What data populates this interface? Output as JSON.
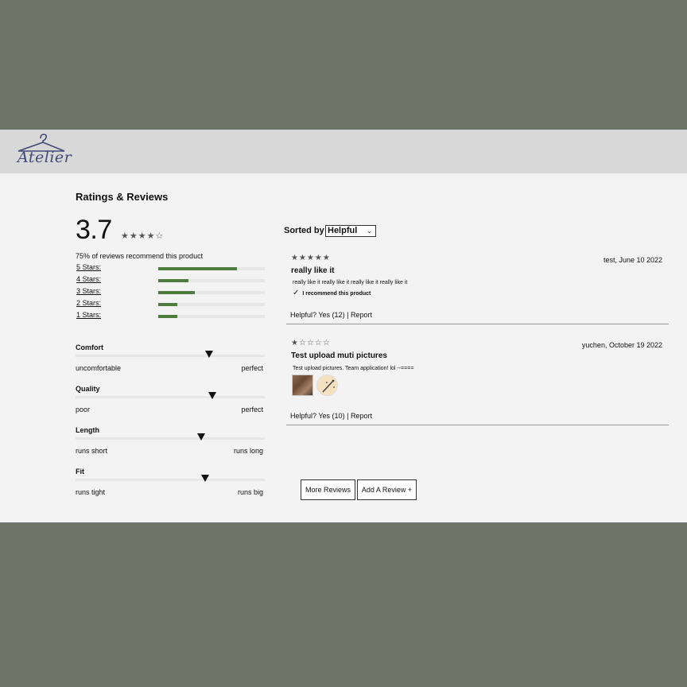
{
  "brand": {
    "logo_text": "Atelier"
  },
  "ratings": {
    "title": "Ratings & Reviews",
    "average": "3.7",
    "average_stars": "★★★★☆",
    "recommend_text": "75% of reviews recommend this product",
    "breakdown": [
      {
        "label": "5 Stars:",
        "fraction": 0.74
      },
      {
        "label": "4 Stars:",
        "fraction": 0.28
      },
      {
        "label": "3 Stars:",
        "fraction": 0.34
      },
      {
        "label": "2 Stars:",
        "fraction": 0.18
      },
      {
        "label": "1 Stars:",
        "fraction": 0.18
      }
    ],
    "characteristics": [
      {
        "name": "Comfort",
        "low": "uncomfortable",
        "high": "perfect",
        "value": 0.71
      },
      {
        "name": "Quality",
        "low": "poor",
        "high": "perfect",
        "value": 0.73
      },
      {
        "name": "Length",
        "low": "runs short",
        "high": "runs long",
        "value": 0.67
      },
      {
        "name": "Fit",
        "low": "runs tight",
        "high": "runs big",
        "value": 0.69
      }
    ]
  },
  "sort": {
    "label": "Sorted by",
    "selected": "Helpful"
  },
  "reviews": [
    {
      "stars": "★★★★★",
      "meta": "test, June 10 2022",
      "title": "really like it",
      "body": "really like it really like it really like it really like it",
      "recommend": "I recommend this product",
      "helpful_prefix": "Helpful?",
      "yes": "Yes (12)",
      "sep": "|",
      "report": "Report"
    },
    {
      "stars": "★☆☆☆☆",
      "meta": "yuchen, October 19 2022",
      "title": "Test upload muti pictures",
      "body": "Test upload pictures. Team application! lol --====",
      "helpful_prefix": "Helpful?",
      "yes": "Yes (10)",
      "sep": "|",
      "report": "Report"
    }
  ],
  "buttons": {
    "more": "More Reviews",
    "add": "Add A Review +"
  },
  "colors": {
    "accent_bar": "#4d7c3e",
    "header_bg": "#d8d8d8",
    "logo": "#434a78",
    "backdrop": "#6f7468"
  }
}
